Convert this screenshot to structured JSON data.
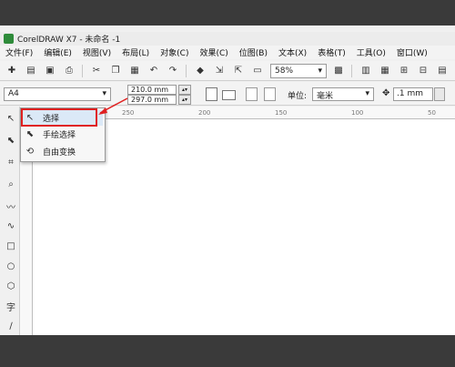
{
  "window": {
    "title": "CorelDRAW X7 - 未命名 -1"
  },
  "menu": [
    "文件(F)",
    "编辑(E)",
    "视图(V)",
    "布局(L)",
    "对象(C)",
    "效果(C)",
    "位图(B)",
    "文本(X)",
    "表格(T)",
    "工具(O)",
    "窗口(W)"
  ],
  "toolbar": {
    "zoom_value": "58%"
  },
  "property_bar": {
    "paper_size": "A4",
    "width": "210.0 mm",
    "height": "297.0 mm",
    "unit_label": "单位:",
    "unit_value": "毫米",
    "nudge_value": ".1 mm"
  },
  "ruler": {
    "ticks": [
      "250",
      "200",
      "150",
      "100",
      "50"
    ]
  },
  "flyout": {
    "items": [
      {
        "label": "选择",
        "icon": "pick-arrow-icon"
      },
      {
        "label": "手绘选择",
        "icon": "freehand-pick-icon"
      },
      {
        "label": "自由变换",
        "icon": "free-transform-icon"
      }
    ]
  },
  "colors": {
    "highlight": "#e02020",
    "canvas": "#ffffff",
    "chrome": "#f0f0f0"
  }
}
